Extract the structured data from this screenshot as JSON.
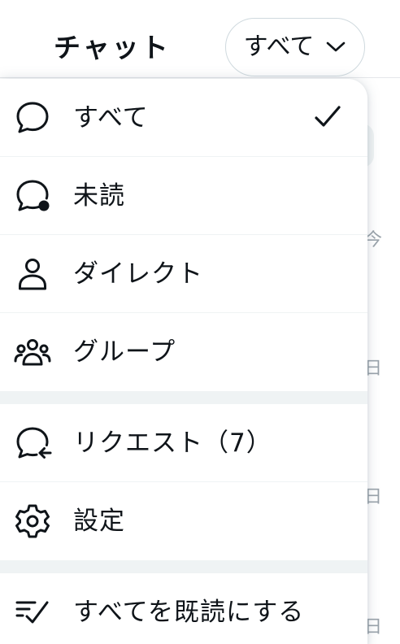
{
  "header": {
    "title": "チャット",
    "filter_label": "すべて",
    "filter_icon": "chevron-down-icon"
  },
  "background": {
    "fragments": [
      "今",
      "日",
      "日",
      "日"
    ]
  },
  "menu": {
    "items": [
      {
        "label": "すべて",
        "icon": "chat-bubble-icon",
        "selected": true
      },
      {
        "label": "未読",
        "icon": "chat-bubble-unread-icon",
        "selected": false
      },
      {
        "label": "ダイレクト",
        "icon": "person-icon",
        "selected": false
      },
      {
        "label": "グループ",
        "icon": "group-icon",
        "selected": false
      },
      {
        "label": "リクエスト（7）",
        "icon": "chat-bubble-request-icon",
        "selected": false
      },
      {
        "label": "設定",
        "icon": "gear-icon",
        "selected": false
      },
      {
        "label": "すべてを既読にする",
        "icon": "mark-all-read-icon",
        "selected": false
      }
    ],
    "selected_indicator_icon": "checkmark-icon"
  },
  "colors": {
    "text": "#0f1419",
    "border": "#cfd9de",
    "separator": "#eff3f4"
  }
}
